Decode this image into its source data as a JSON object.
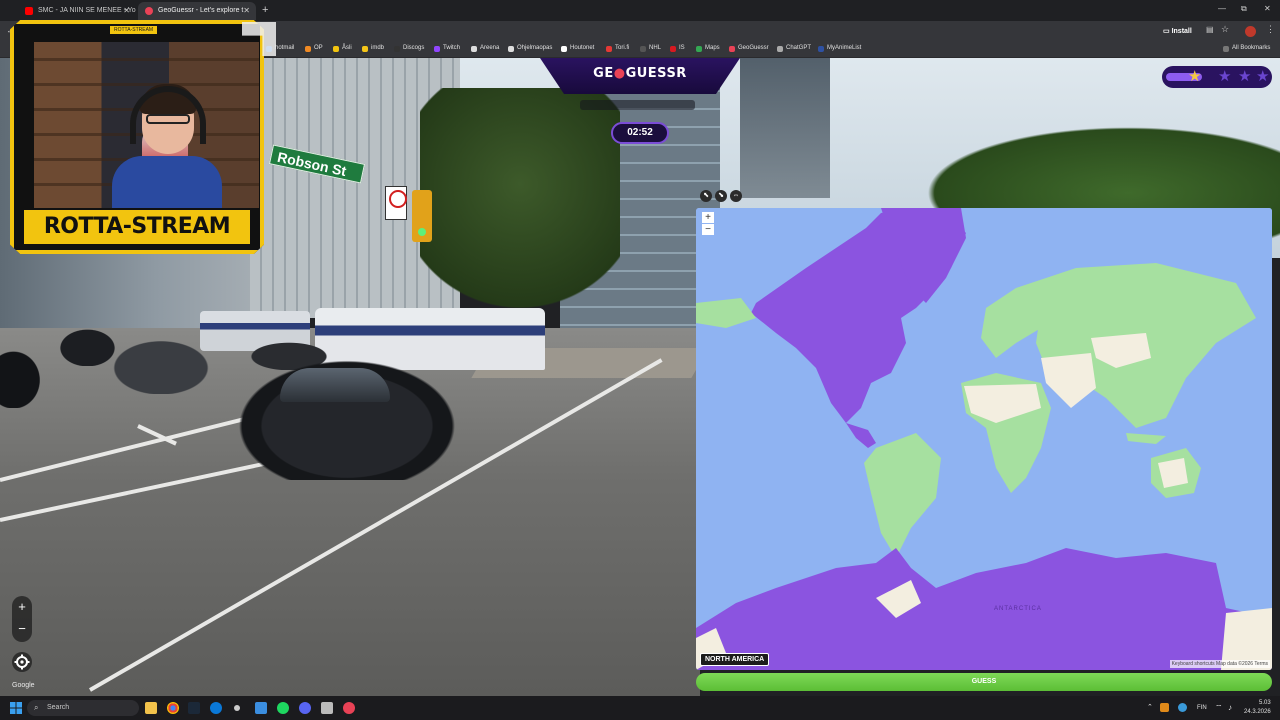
{
  "browser": {
    "tabs": [
      {
        "title": "SMC - JA NIIN SE MENEE - Yo",
        "favicon_color": "#ff0000"
      },
      {
        "title": "GeoGuessr - Let's explore t",
        "favicon_color": "#e94256"
      }
    ],
    "new_tab": "+",
    "window_controls": [
      "—",
      "⧉",
      "✕"
    ],
    "install_label": "Install",
    "bookmarks": [
      {
        "label": "hotmail",
        "color": "#1a73e8"
      },
      {
        "label": "OP",
        "color": "#f08a24"
      },
      {
        "label": "Åsli",
        "color": "#f2c40f"
      },
      {
        "label": "imdb",
        "color": "#f5c518"
      },
      {
        "label": "Discogs",
        "color": "#333333"
      },
      {
        "label": "Twitch",
        "color": "#9146ff"
      },
      {
        "label": "Areena",
        "color": "#dddddd"
      },
      {
        "label": "Ohjelmaopas",
        "color": "#dddddd"
      },
      {
        "label": "Houtonet",
        "color": "#ffffff"
      },
      {
        "label": "Tori.fi",
        "color": "#e53935"
      },
      {
        "label": "NHL",
        "color": "#555555"
      },
      {
        "label": "IS",
        "color": "#d71920"
      },
      {
        "label": "Maps",
        "color": "#34a853"
      },
      {
        "label": "GeoGuessr",
        "color": "#e94256"
      },
      {
        "label": "ChatGPT",
        "color": "#aaaaaa"
      },
      {
        "label": "MyAnimeList",
        "color": "#2e51a2"
      }
    ],
    "all_bookmarks": "All Bookmarks"
  },
  "webcam": {
    "top_label": "ROTTA-STREAM",
    "streamer_name": "ROTTA-STREAM"
  },
  "street": {
    "sign_text": "Robson St"
  },
  "game": {
    "logo_prefix": "GE",
    "logo_pin": "●",
    "logo_suffix": "GUESSR",
    "timer": "02:52",
    "stars_filled": 1,
    "stars_total": 4,
    "round_progress": 0.33,
    "map_zoom_in": "+",
    "map_zoom_out": "−",
    "map_region_label": "NORTH AMERICA",
    "map_antarctica": "ANTARCTICA",
    "map_attribution": "Keyboard shortcuts   Map data ©2026   Terms",
    "guess_label": "GUESS",
    "map_colors": {
      "ocean": "#8fb3f2",
      "land": "#a6e0a0",
      "desert": "#f3eee0",
      "highlight": "#8b54e0"
    }
  },
  "streetview": {
    "zoom_in": "+",
    "zoom_out": "−",
    "settings_icon": "gear-icon",
    "google_mark": "Google"
  },
  "taskbar": {
    "search_placeholder": "Search",
    "language": "FIN",
    "time": "5.03",
    "date": "24.3.2026"
  }
}
